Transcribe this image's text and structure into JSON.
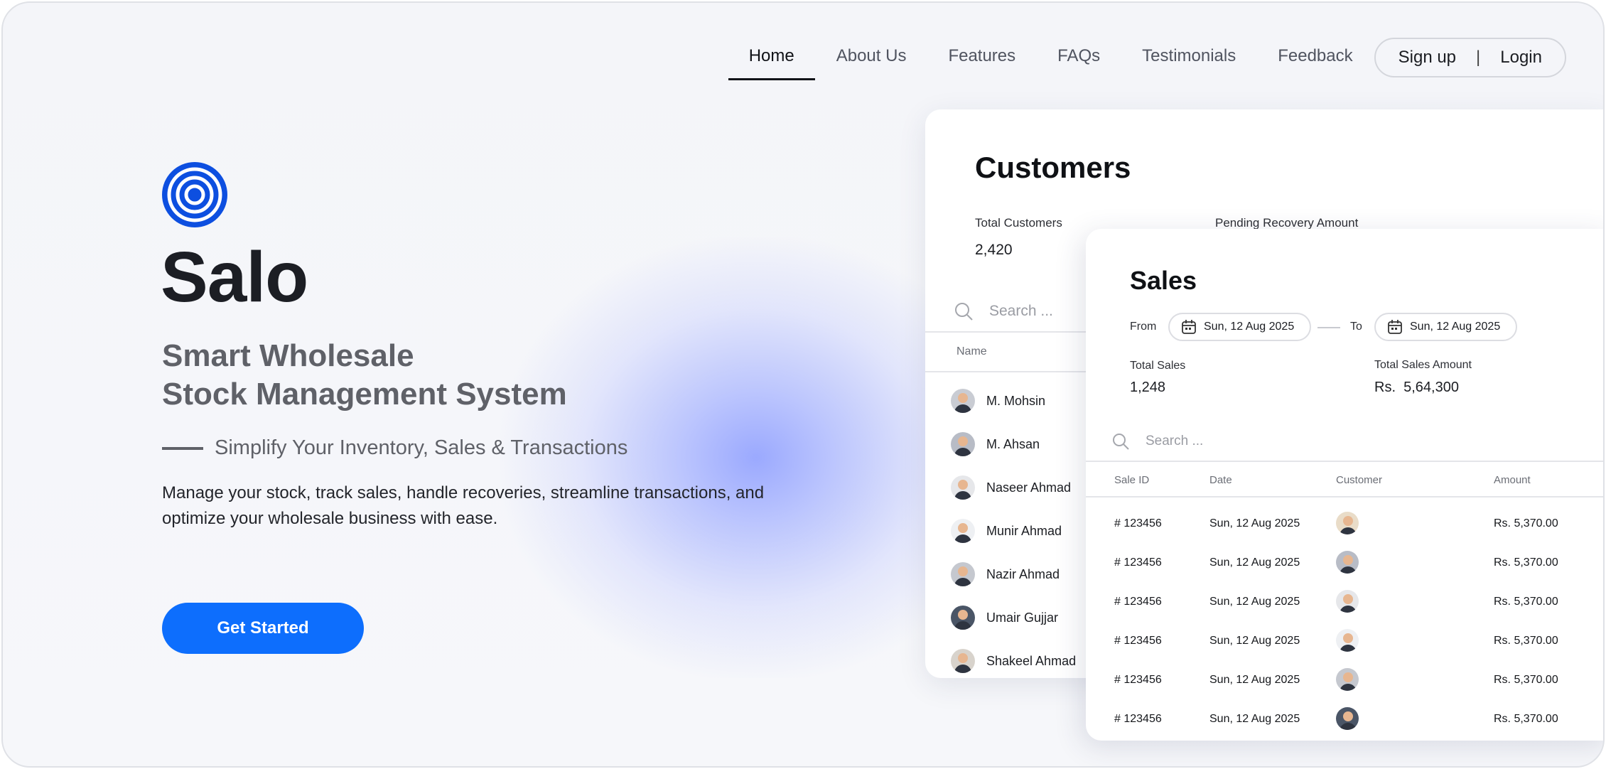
{
  "nav": {
    "items": [
      {
        "label": "Home",
        "active": true
      },
      {
        "label": "About Us"
      },
      {
        "label": "Features"
      },
      {
        "label": "FAQs"
      },
      {
        "label": "Testimonials"
      },
      {
        "label": "Feedback"
      }
    ],
    "signup_label": "Sign up",
    "separator": "|",
    "login_label": "Login"
  },
  "hero": {
    "brand": "Salo",
    "tagline_line1": "Smart Wholesale",
    "tagline_line2": "Stock Management System",
    "subtitle": "Simplify Your Inventory, Sales & Transactions",
    "description": "Manage your stock, track sales, handle recoveries, streamline transactions, and optimize your wholesale business with ease.",
    "cta_label": "Get Started",
    "accent_color": "#0d6efd"
  },
  "customers": {
    "title": "Customers",
    "total_label": "Total Customers",
    "total_value": "2,420",
    "pending_label": "Pending Recovery Amount",
    "search_placeholder": "Search ...",
    "name_header": "Name",
    "rows": [
      {
        "name": "M. Mohsin"
      },
      {
        "name": "M. Ahsan"
      },
      {
        "name": "Naseer Ahmad"
      },
      {
        "name": "Munir Ahmad"
      },
      {
        "name": "Nazir Ahmad"
      },
      {
        "name": "Umair Gujjar"
      },
      {
        "name": "Shakeel Ahmad"
      }
    ]
  },
  "sales": {
    "title": "Sales",
    "from_label": "From",
    "from_date": "Sun, 12 Aug 2025",
    "to_label": "To",
    "to_date": "Sun, 12 Aug 2025",
    "total_sales_label": "Total Sales",
    "total_sales_value": "1,248",
    "total_amount_label": "Total Sales Amount",
    "total_amount_value": "Rs.  5,64,300",
    "search_placeholder": "Search ...",
    "headers": {
      "id": "Sale ID",
      "date": "Date",
      "customer": "Customer",
      "amount": "Amount"
    },
    "rows": [
      {
        "id": "# 123456",
        "date": "Sun, 12 Aug 2025",
        "amount": "Rs. 5,370.00"
      },
      {
        "id": "# 123456",
        "date": "Sun, 12 Aug 2025",
        "amount": "Rs. 5,370.00"
      },
      {
        "id": "# 123456",
        "date": "Sun, 12 Aug 2025",
        "amount": "Rs. 5,370.00"
      },
      {
        "id": "# 123456",
        "date": "Sun, 12 Aug 2025",
        "amount": "Rs. 5,370.00"
      },
      {
        "id": "# 123456",
        "date": "Sun, 12 Aug 2025",
        "amount": "Rs. 5,370.00"
      },
      {
        "id": "# 123456",
        "date": "Sun, 12 Aug 2025",
        "amount": "Rs. 5,370.00"
      }
    ]
  }
}
